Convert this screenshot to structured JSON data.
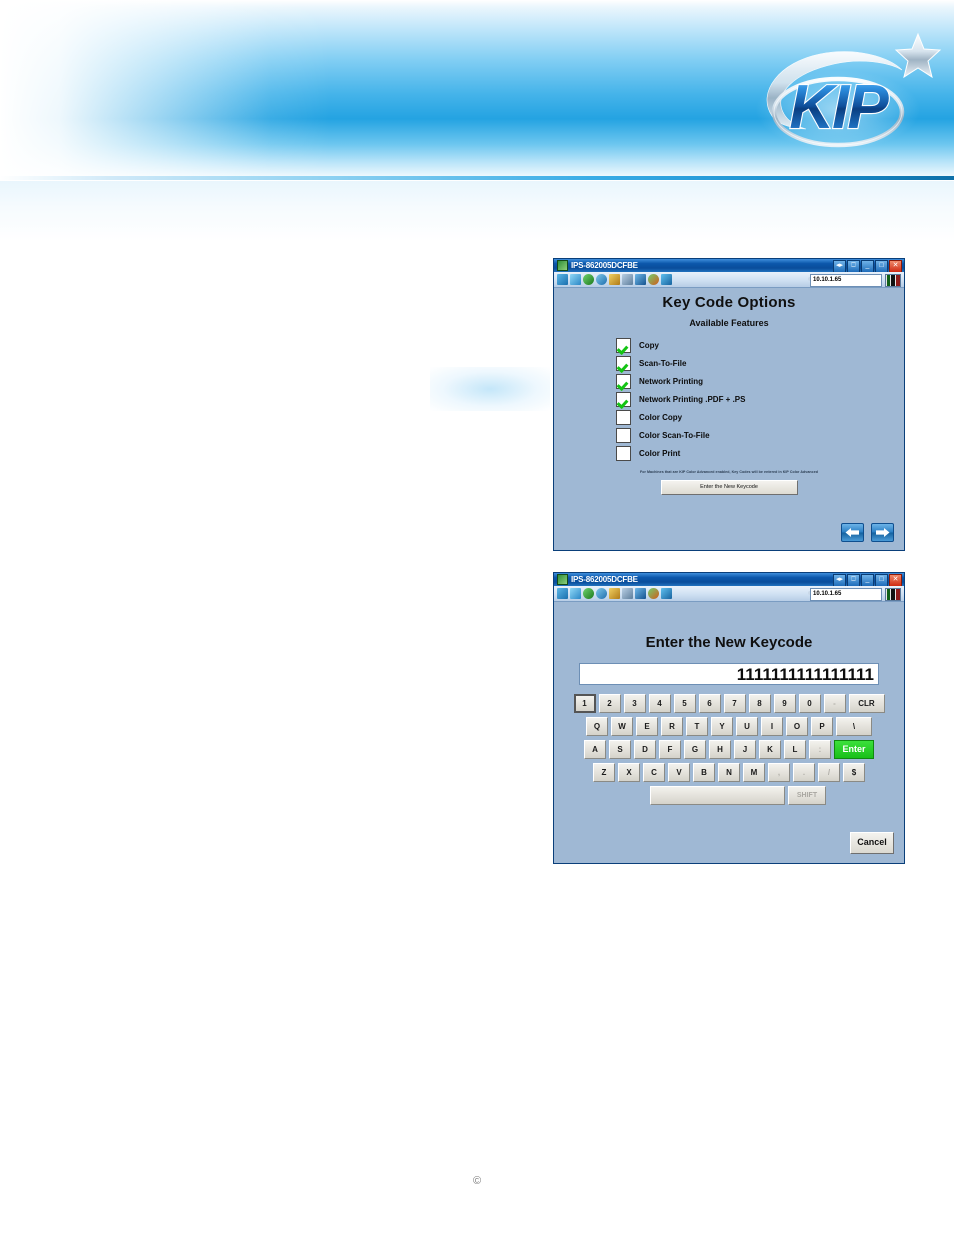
{
  "header": {
    "logo_text": "KIP",
    "logo_name": "kip-logo"
  },
  "window1": {
    "titlebar": {
      "title": "IPS-862005DCFBE",
      "buttons": [
        "restore-left",
        "restore",
        "minimize",
        "maximize",
        "close"
      ],
      "button_glyphs": [
        "◀▶",
        "❐",
        "_",
        "□",
        "✕"
      ]
    },
    "toolbar": {
      "ip_value": "10.10.1.65",
      "icons": [
        "network-icon",
        "monitor-icon",
        "globe-icon",
        "settings-icon",
        "media-icon",
        "chart-icon",
        "info-icon",
        "world-icon",
        "filter-icon"
      ]
    },
    "title": "Key Code Options",
    "subtitle": "Available Features",
    "features": [
      {
        "label": "Copy",
        "checked": true
      },
      {
        "label": "Scan-To-File",
        "checked": true
      },
      {
        "label": "Network Printing",
        "checked": true
      },
      {
        "label": "Network Printing .PDF + .PS",
        "checked": true
      },
      {
        "label": "Color Copy",
        "checked": false
      },
      {
        "label": "Color Scan-To-File",
        "checked": false
      },
      {
        "label": "Color Print",
        "checked": false
      }
    ],
    "disclaimer": "For Machines that are KIP Color Advanced enabled, Key Codes will be entered in KIP Color Advanced",
    "enter_keycode_button": "Enter the New Keycode",
    "nav": {
      "back": "back-arrow",
      "forward": "forward-arrow"
    }
  },
  "window2": {
    "titlebar": {
      "title": "IPS-862005DCFBE"
    },
    "toolbar": {
      "ip_value": "10.10.1.65"
    },
    "title": "Enter the New Keycode",
    "input_value": "1111111111111111",
    "keyboard": {
      "row1": [
        "1",
        "2",
        "3",
        "4",
        "5",
        "6",
        "7",
        "8",
        "9",
        "0",
        "-",
        "CLR"
      ],
      "row2": [
        "Q",
        "W",
        "E",
        "R",
        "T",
        "Y",
        "U",
        "I",
        "O",
        "P",
        "\\"
      ],
      "row3": [
        "A",
        "S",
        "D",
        "F",
        "G",
        "H",
        "J",
        "K",
        "L",
        ":",
        "Enter"
      ],
      "row4": [
        "Z",
        "X",
        "C",
        "V",
        "B",
        "N",
        "M",
        ",",
        ".",
        "/",
        "$"
      ],
      "row5": [
        "",
        "SHIFT"
      ],
      "space_label": "",
      "shift_label": "SHIFT",
      "enter_label": "Enter",
      "selected_key": "1"
    },
    "cancel_button": "Cancel"
  },
  "footer": {
    "copyright_symbol": "©"
  }
}
